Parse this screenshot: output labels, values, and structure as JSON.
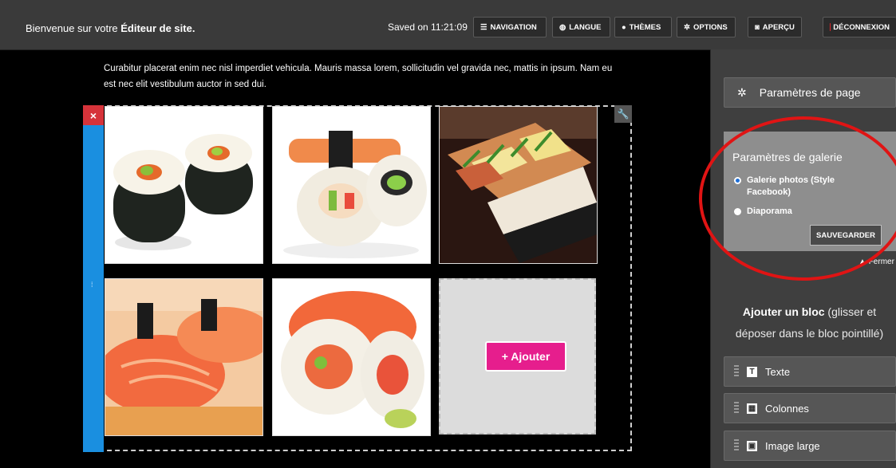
{
  "topbar": {
    "welcome_prefix": "Bienvenue sur votre",
    "welcome_bold": "Éditeur de site.",
    "saved": "Saved on 11:21:09",
    "buttons": [
      {
        "label": "NAVIGATION",
        "icon": "list-icon"
      },
      {
        "label": "LANGUE",
        "icon": "globe-icon"
      },
      {
        "label": "THÈMES",
        "icon": "droplet-icon"
      },
      {
        "label": "OPTIONS",
        "icon": "gear-icon"
      },
      {
        "label": "APERÇU",
        "icon": "camera-icon"
      },
      {
        "label": "DÉCONNEXION",
        "icon": "logout-icon"
      }
    ]
  },
  "main": {
    "intro": "Curabitur placerat enim nec nisl imperdiet vehicula. Mauris massa lorem, sollicitudin vel gravida nec, mattis in ipsum. Nam eu est nec elit vestibulum auctor in sed dui.",
    "add_button": "+ Ajouter"
  },
  "panel": {
    "page_settings": "Paramètres de page",
    "gallery_settings_title": "Paramètres de galerie",
    "option_facebook": "Galerie photos (Style Facebook)",
    "option_slideshow": "Diaporama",
    "save": "SAUVEGARDER",
    "close": "Fermer",
    "add_block_bold": "Ajouter un bloc",
    "add_block_rest": " (glisser et déposer dans le bloc pointillé)",
    "blocks": [
      "Texte",
      "Colonnes",
      "Image large"
    ]
  },
  "colors": {
    "accent_pink": "#e61e8d",
    "handle_blue": "#1a8fe0",
    "highlight_red": "#e01414"
  }
}
